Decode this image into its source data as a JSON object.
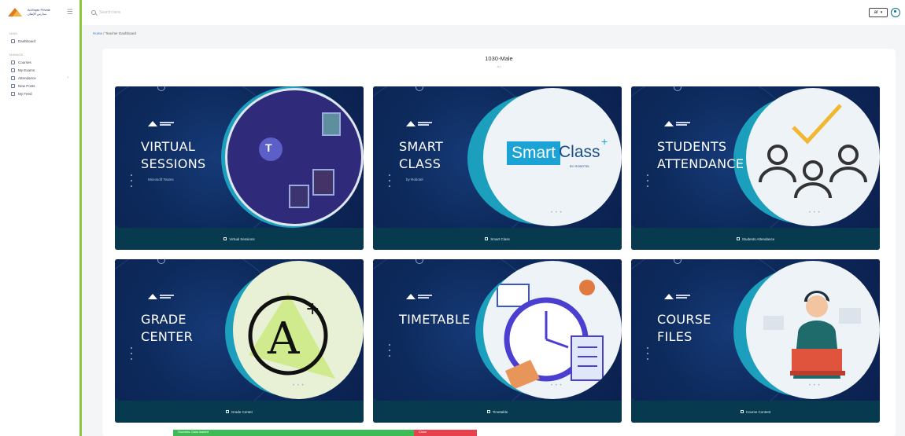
{
  "sidebar": {
    "brand_line1": "Al-Etqan Private",
    "brand_line2": "مدارس الإتقان",
    "section_main": "MAIN",
    "dashboard_label": "Dashboard",
    "section_more": "MANAGE",
    "items": [
      {
        "label": "Courses",
        "icon": "book-icon"
      },
      {
        "label": "My Exams",
        "icon": "exam-icon"
      },
      {
        "label": "Attendance",
        "icon": "calendar-icon",
        "chevron": "›"
      },
      {
        "label": "New Posts",
        "icon": "post-icon"
      },
      {
        "label": "My Feed",
        "icon": "feed-icon"
      }
    ]
  },
  "topbar": {
    "search_placeholder": "Search here",
    "lang_value": "ar"
  },
  "breadcrumb": {
    "home": "Home",
    "sep": "/",
    "current": "Teacher Dashboard"
  },
  "class_title": "1030-Male",
  "class_sub": "A1",
  "cards": [
    {
      "title_line1": "VIRTUAL",
      "title_line2": "SESSIONS",
      "sub": "Microsoft Teams",
      "footer": "Virtual Sessions"
    },
    {
      "title_line1": "SMART",
      "title_line2": "CLASS",
      "sub": "by Robotel",
      "footer": "Smart Class",
      "logo_smart": "Smart",
      "logo_class": "Class",
      "logo_plus": "+",
      "logo_by": "BY ROBOTEL"
    },
    {
      "title_line1": "STUDENTS",
      "title_line2": "ATTENDANCE",
      "sub": "",
      "footer": "Students Attendance"
    },
    {
      "title_line1": "GRADE",
      "title_line2": "CENTER",
      "sub": "",
      "footer": "Grade Center"
    },
    {
      "title_line1": "TIMETABLE",
      "title_line2": "",
      "sub": "",
      "footer": "Timetable"
    },
    {
      "title_line1": "COURSE",
      "title_line2": "FILES",
      "sub": "",
      "footer": "Course Content"
    }
  ],
  "notification": {
    "green_text": "Success: Data loaded",
    "red_text": "Close"
  },
  "colors": {
    "accent_green": "#8cc63f",
    "card_bg": "#0c2552",
    "footer_bg": "#073a4f",
    "teal": "#1b9fbd",
    "brand_orange": "#e07a1f"
  }
}
